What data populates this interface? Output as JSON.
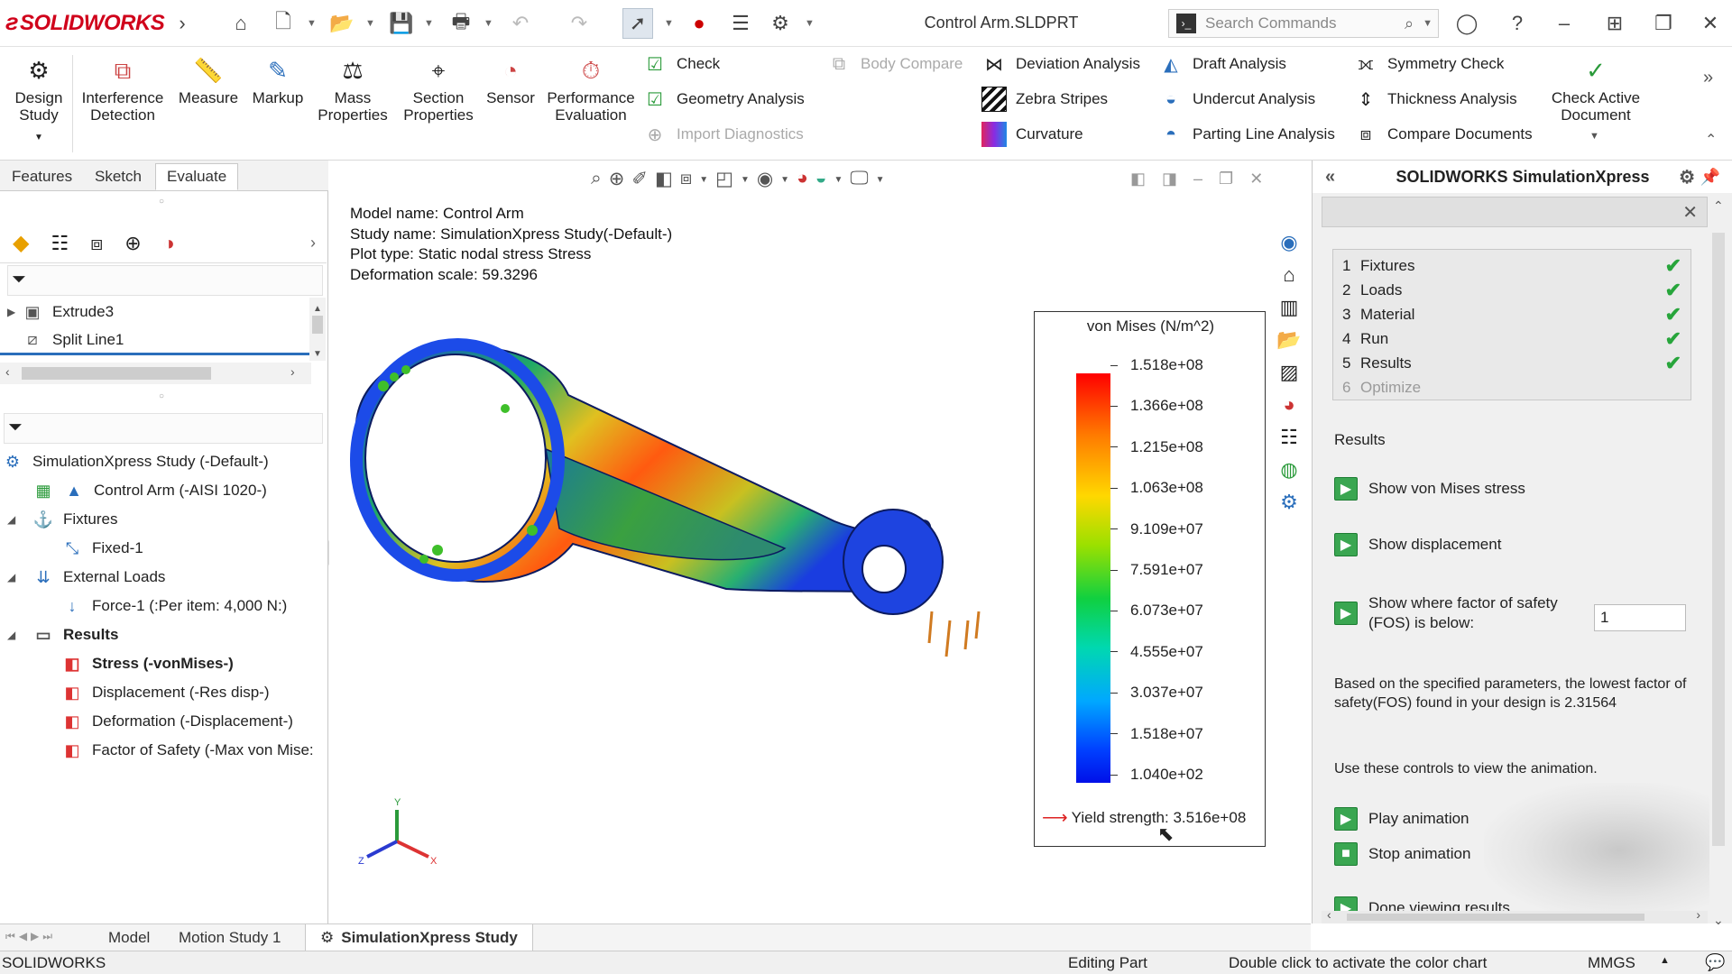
{
  "app": {
    "brand": "SOLIDWORKS",
    "doc_title": "Control Arm.SLDPRT"
  },
  "search": {
    "placeholder": "Search Commands"
  },
  "ribbon": {
    "big": [
      {
        "label": "Design\nStudy",
        "icon": "design-study-icon"
      },
      {
        "label": "Interference\nDetection",
        "icon": "interference-icon"
      },
      {
        "label": "Measure",
        "icon": "measure-icon"
      },
      {
        "label": "Markup",
        "icon": "markup-icon"
      },
      {
        "label": "Mass\nProperties",
        "icon": "mass-icon"
      },
      {
        "label": "Section\nProperties",
        "icon": "section-icon"
      },
      {
        "label": "Sensor",
        "icon": "sensor-icon"
      },
      {
        "label": "Performance\nEvaluation",
        "icon": "performance-icon"
      }
    ],
    "check": "Check",
    "geometry_analysis": "Geometry Analysis",
    "import_diagnostics": "Import Diagnostics",
    "body_compare": "Body Compare",
    "deviation_analysis": "Deviation Analysis",
    "zebra_stripes": "Zebra Stripes",
    "curvature": "Curvature",
    "draft_analysis": "Draft Analysis",
    "undercut_analysis": "Undercut Analysis",
    "parting_line_analysis": "Parting Line Analysis",
    "symmetry_check": "Symmetry Check",
    "thickness_analysis": "Thickness Analysis",
    "compare_documents": "Compare Documents",
    "check_active_document": "Check Active\nDocument"
  },
  "tabs": {
    "features": "Features",
    "sketch": "Sketch",
    "evaluate": "Evaluate"
  },
  "feature_tree": {
    "top_items": [
      "Extrude3",
      "Split Line1"
    ]
  },
  "sim_tree": {
    "study": "SimulationXpress Study (-Default-)",
    "part": "Control Arm (-AISI 1020-)",
    "fixtures": "Fixtures",
    "fixed": "Fixed-1",
    "external_loads": "External Loads",
    "force": "Force-1 (:Per item: 4,000 N:)",
    "results": "Results",
    "stress": "Stress (-vonMises-)",
    "displacement": "Displacement (-Res disp-)",
    "deformation": "Deformation (-Displacement-)",
    "fos": "Factor of Safety (-Max von Mise:"
  },
  "viewport": {
    "model_name": "Model name: Control Arm",
    "study_name": "Study name: SimulationXpress Study(-Default-)",
    "plot_type": "Plot type: Static nodal stress Stress",
    "deformation_scale": "Deformation scale: 59.3296"
  },
  "legend": {
    "title": "von Mises (N/m^2)",
    "values": [
      "1.518e+08",
      "1.366e+08",
      "1.215e+08",
      "1.063e+08",
      "9.109e+07",
      "7.591e+07",
      "6.073e+07",
      "4.555e+07",
      "3.037e+07",
      "1.518e+07",
      "1.040e+02"
    ],
    "yield": "Yield strength: 3.516e+08"
  },
  "simxpress": {
    "title": "SOLIDWORKS SimulationXpress",
    "steps": [
      {
        "num": "1",
        "label": "Fixtures",
        "done": true
      },
      {
        "num": "2",
        "label": "Loads",
        "done": true
      },
      {
        "num": "3",
        "label": "Material",
        "done": true
      },
      {
        "num": "4",
        "label": "Run",
        "done": true
      },
      {
        "num": "5",
        "label": "Results",
        "done": true
      },
      {
        "num": "6",
        "label": "Optimize",
        "done": false
      }
    ],
    "results_heading": "Results",
    "show_von_mises": "Show von Mises stress",
    "show_displacement": "Show displacement",
    "show_fos": "Show where factor of safety\n(FOS) is below:",
    "fos_value": "1",
    "summary": "Based on the specified parameters, the lowest factor of safety(FOS) found in your design is 2.31564",
    "anim_hint": "Use these controls to view the animation.",
    "play": "Play animation",
    "stop": "Stop animation",
    "done": "Done viewing results"
  },
  "bottom_tabs": {
    "model": "Model",
    "motion": "Motion Study 1",
    "sim": "SimulationXpress Study"
  },
  "status": {
    "app": "SOLIDWORKS",
    "mode": "Editing Part",
    "hint": "Double click to activate the color chart",
    "units": "MMGS"
  }
}
